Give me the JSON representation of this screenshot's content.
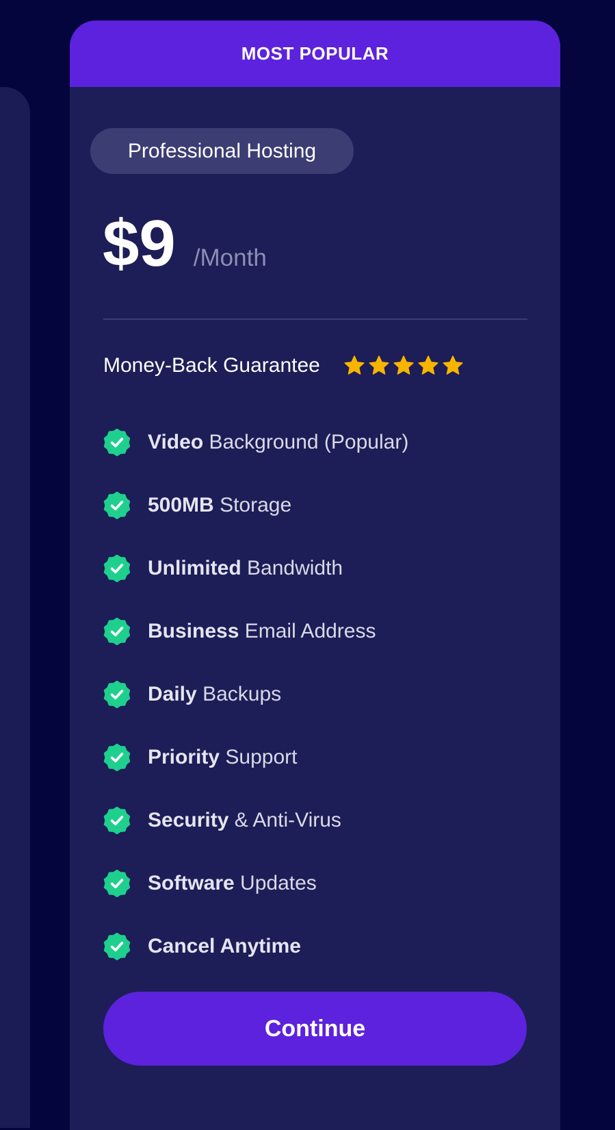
{
  "background_color": "#05053d",
  "card": {
    "banner": "MOST POPULAR",
    "plan_name": "Professional Hosting",
    "price": "$9",
    "period": "/Month",
    "guarantee": "Money-Back Guarantee",
    "rating_stars": 5,
    "star_icon": "star-icon",
    "check_icon": "check-badge-icon",
    "accent_color": "#5c22dd",
    "check_color": "#1fcf8e",
    "star_color": "#f7b500",
    "features": [
      {
        "bold": "Video",
        "rest": "Background (Popular)"
      },
      {
        "bold": "500MB",
        "rest": "Storage"
      },
      {
        "bold": "Unlimited",
        "rest": "Bandwidth"
      },
      {
        "bold": "Business",
        "rest": "Email Address"
      },
      {
        "bold": "Daily",
        "rest": "Backups"
      },
      {
        "bold": "Priority",
        "rest": "Support"
      },
      {
        "bold": "Security",
        "rest": "& Anti-Virus"
      },
      {
        "bold": "Software",
        "rest": "Updates"
      },
      {
        "bold": "Cancel Anytime",
        "rest": ""
      }
    ],
    "cta_label": "Continue"
  }
}
